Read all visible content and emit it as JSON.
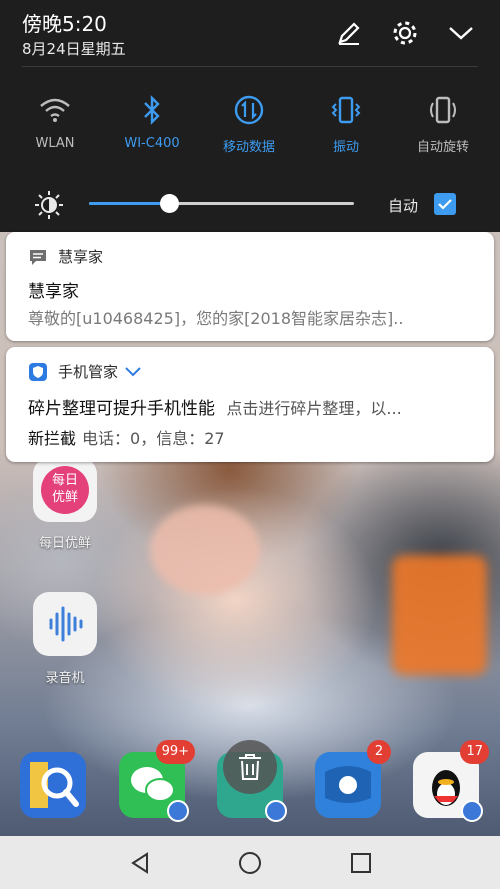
{
  "status_bar": {
    "time": "傍晚5:20",
    "date": "8月24日星期五"
  },
  "quick_settings": {
    "tiles": [
      {
        "label": "WLAN",
        "active": false,
        "icon": "wifi-icon"
      },
      {
        "label": "WI-C400",
        "active": true,
        "icon": "bluetooth-icon"
      },
      {
        "label": "移动数据",
        "active": true,
        "icon": "mobile-data-icon"
      },
      {
        "label": "振动",
        "active": true,
        "icon": "vibrate-icon"
      },
      {
        "label": "自动旋转",
        "active": false,
        "icon": "auto-rotate-icon"
      }
    ],
    "brightness": {
      "level": 0.3,
      "auto_label": "自动",
      "auto_checked": true
    }
  },
  "notifications": [
    {
      "app": "慧享家",
      "title": "慧享家",
      "body": "尊敬的[u10468425]，您的家[2018智能家居杂志]..",
      "icon": "message-icon"
    },
    {
      "app": "手机管家",
      "title": "碎片整理可提升手机性能",
      "title_suffix": "点击进行碎片整理，以...",
      "line2_key": "新拦截",
      "line2_value": "电话：0，信息：27",
      "icon": "phone-manager-shield-icon"
    }
  ],
  "home_screen": {
    "apps": [
      {
        "label": "每日优鲜",
        "icon_text": "每日\n优鲜"
      },
      {
        "label": "录音机"
      }
    ],
    "dock": [
      {
        "name": "browser",
        "badge": ""
      },
      {
        "name": "wechat",
        "badge": "99+"
      },
      {
        "name": "maps",
        "badge": ""
      },
      {
        "name": "mail",
        "badge": "2"
      },
      {
        "name": "qq",
        "badge": "17"
      }
    ]
  },
  "colors": {
    "accent": "#3d9bf0",
    "shade": "#1e1e1e",
    "card": "#ffffff"
  }
}
